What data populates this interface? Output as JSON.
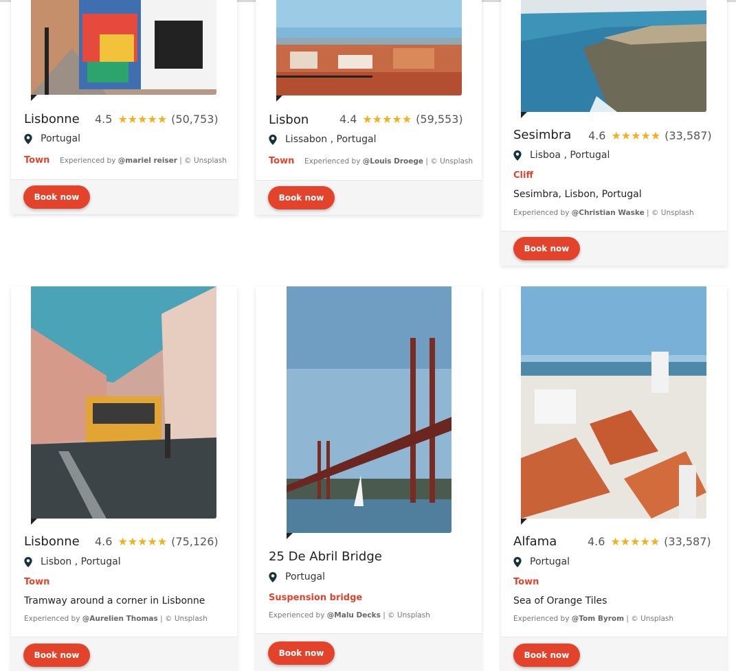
{
  "book_label": "Book now",
  "credit_prefix": "Experienced by",
  "credit_suffix": "| © Unsplash",
  "accent_color": "#e3432a",
  "star_color": "#f2b01e",
  "cards": [
    {
      "title": "Lisbonne",
      "rating": "4.5",
      "stars": "★★★★★",
      "reviews": "(50,753)",
      "location": "Portugal",
      "category": "Town",
      "description": "",
      "credit_user": "@mariel reiser"
    },
    {
      "title": "Lisbon",
      "rating": "4.4",
      "stars": "★★★★★",
      "reviews": "(59,553)",
      "location": "Lissabon , Portugal",
      "category": "Town",
      "description": "",
      "credit_user": "@Louis Droege"
    },
    {
      "title": "Sesimbra",
      "rating": "4.6",
      "stars": "★★★★★",
      "reviews": "(33,587)",
      "location": "Lisboa , Portugal",
      "category": "Cliff",
      "description": "Sesimbra, Lisbon, Portugal",
      "credit_user": "@Christian Waske"
    },
    {
      "title": "Lisbonne",
      "rating": "4.6",
      "stars": "★★★★★",
      "reviews": "(75,126)",
      "location": "Lisbon , Portugal",
      "category": "Town",
      "description": "Tramway around a corner in Lisbonne",
      "credit_user": "@Aurelien Thomas"
    },
    {
      "title": "25 De Abril Bridge",
      "rating": "",
      "stars": "",
      "reviews": "",
      "location": "Portugal",
      "category": "Suspension bridge",
      "description": "",
      "credit_user": "@Malu Decks"
    },
    {
      "title": "Alfama",
      "rating": "4.6",
      "stars": "★★★★★",
      "reviews": "(33,587)",
      "location": "Portugal",
      "category": "Town",
      "description": "Sea of Orange Tiles",
      "credit_user": "@Tom Byrom"
    }
  ]
}
